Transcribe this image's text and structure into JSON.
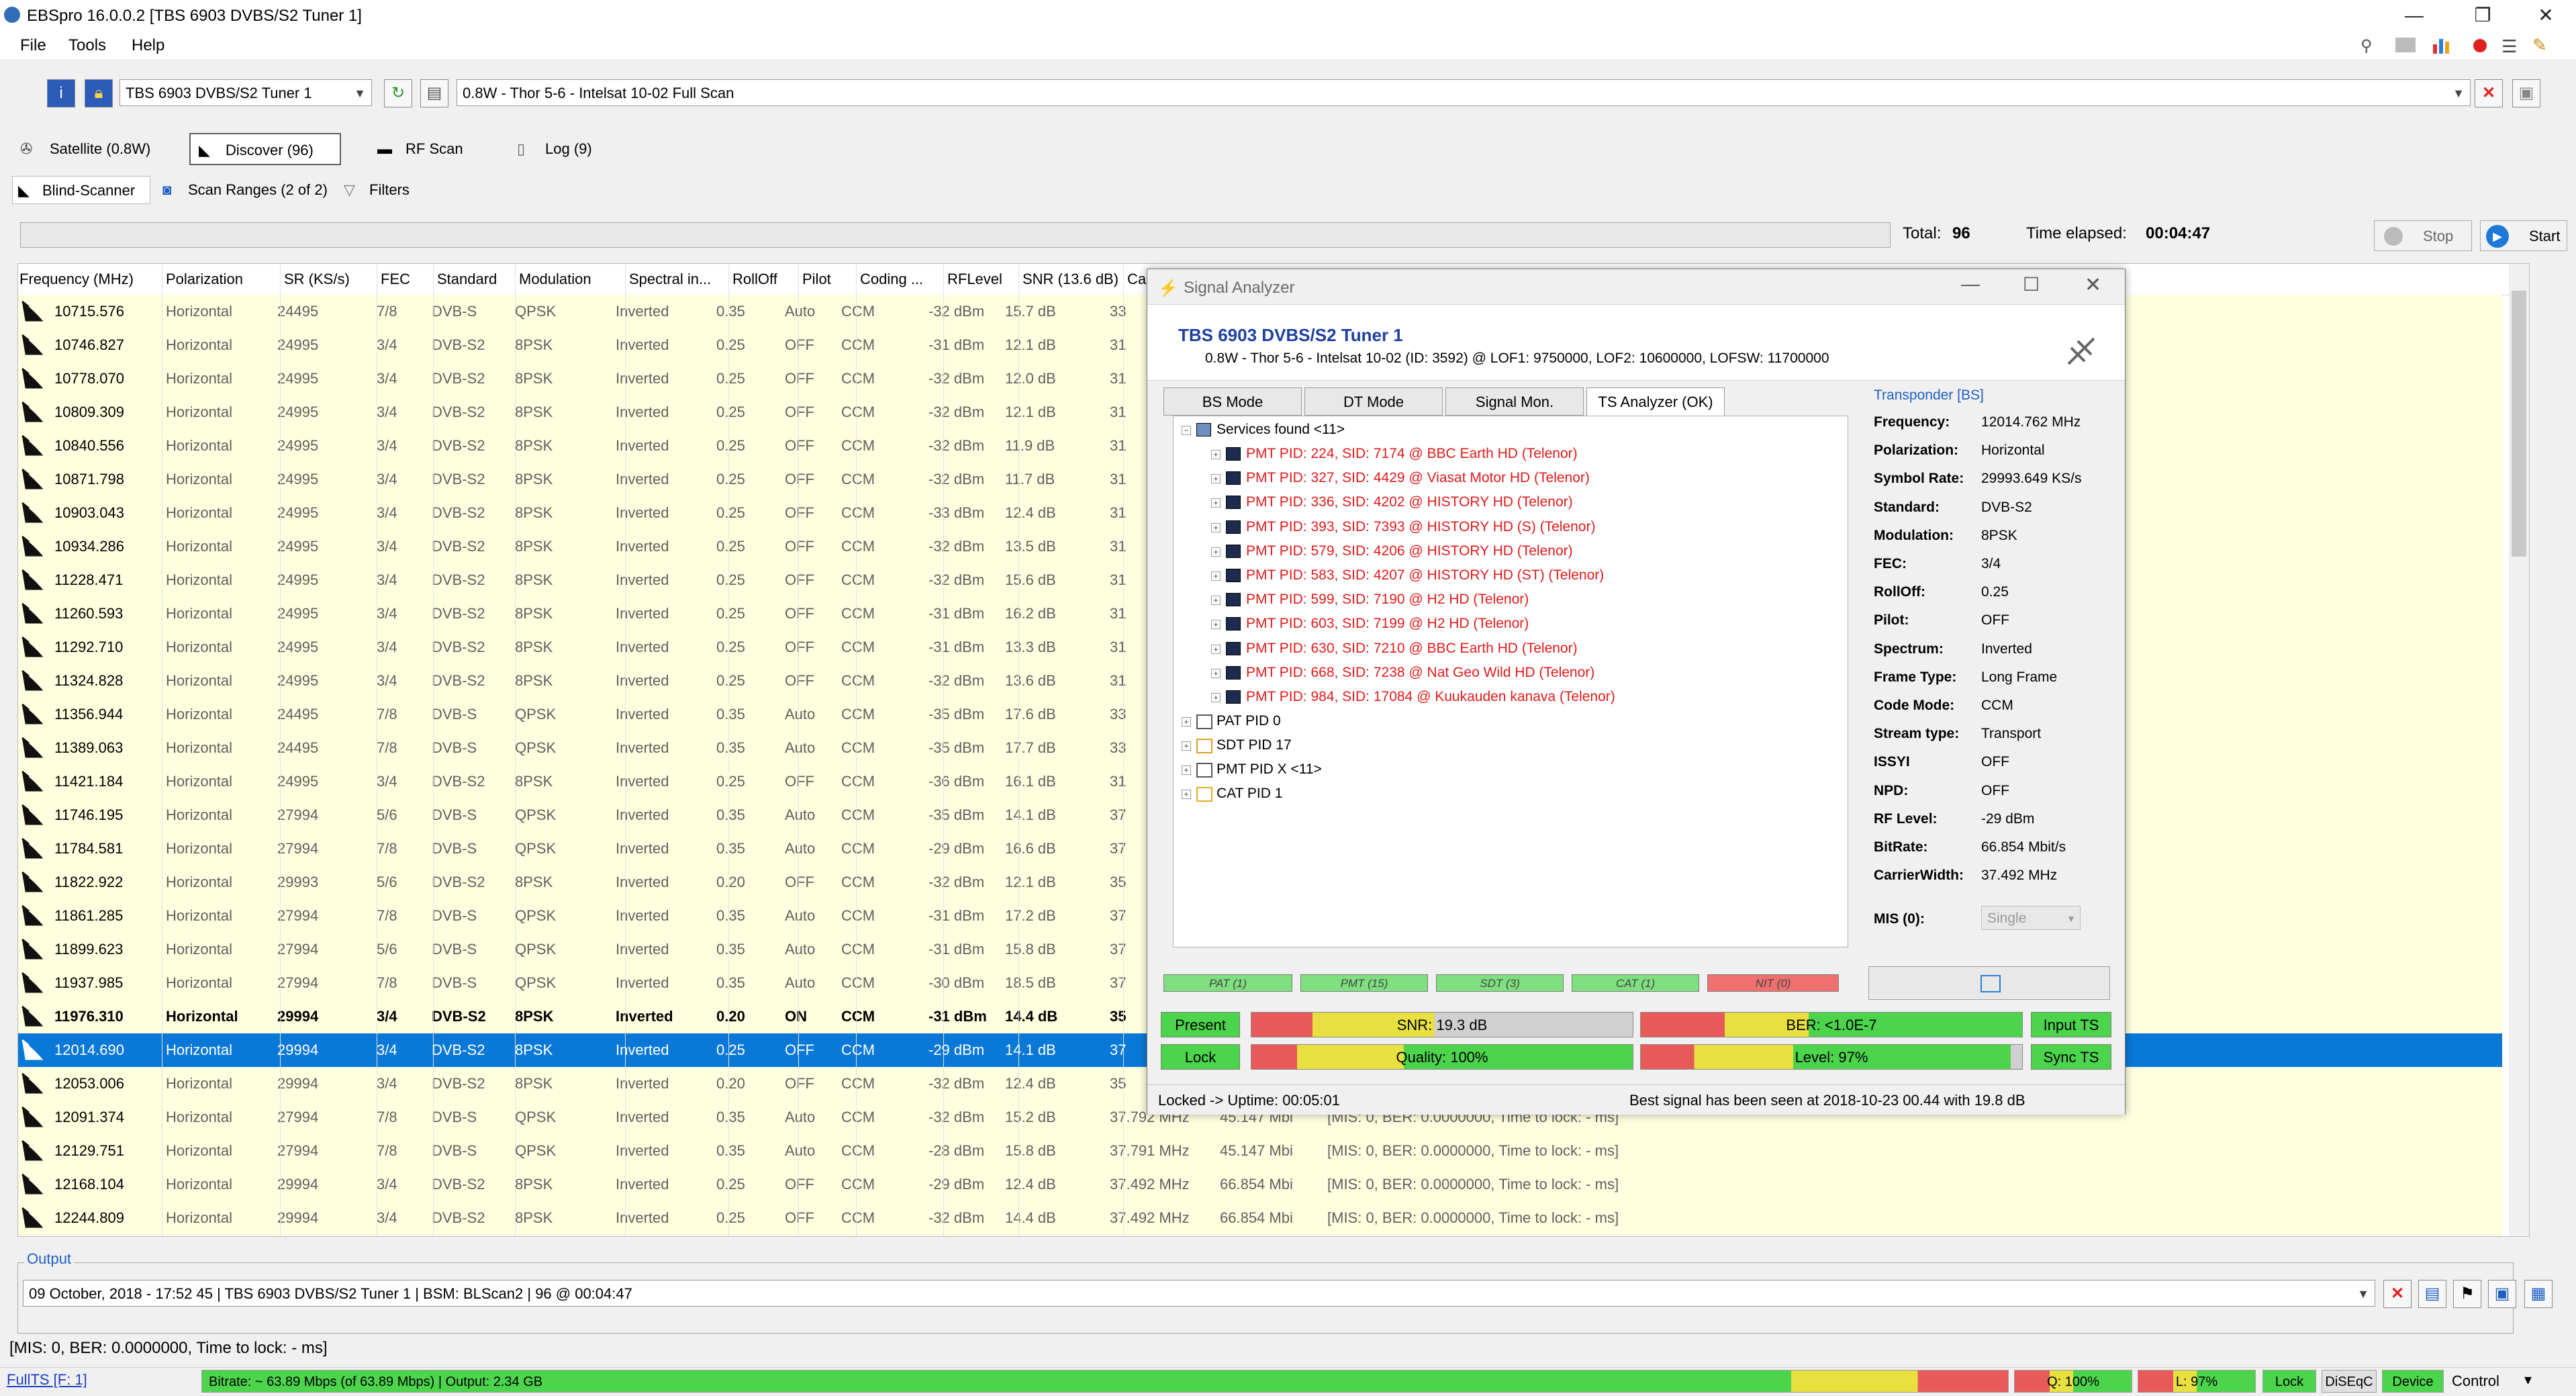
{
  "window": {
    "title": "EBSpro 16.0.0.2 [TBS 6903 DVBS/S2 Tuner 1]",
    "min": "—",
    "max": "❐",
    "close": "✕"
  },
  "menu": [
    "File",
    "Tools",
    "Help"
  ],
  "toolbar": {
    "tuner": "TBS 6903 DVBS/S2 Tuner 1",
    "satellite": "0.8W - Thor 5-6 - Intelsat 10-02 Full Scan"
  },
  "tabs": [
    "Satellite (0.8W)",
    "Discover (96)",
    "RF Scan",
    "Log (9)"
  ],
  "subtabs": [
    "Blind-Scanner",
    "Scan Ranges (2 of 2)",
    "Filters"
  ],
  "scan": {
    "total_label": "Total:",
    "total": "96",
    "elapsed_label": "Time elapsed:",
    "elapsed": "00:04:47",
    "stop": "Stop",
    "start": "Start"
  },
  "columns": [
    "Frequency (MHz)",
    "Polarization",
    "SR (KS/s)",
    "FEC",
    "Standard",
    "Modulation",
    "Spectral in...",
    "RollOff",
    "Pilot",
    "Coding ...",
    "RFLevel",
    "SNR (13.6 dB)",
    "Ca"
  ],
  "rows": [
    [
      "10715.576",
      "Horizontal",
      "24495",
      "7/8",
      "DVB-S",
      "QPSK",
      "Inverted",
      "0.35",
      "Auto",
      "CCM",
      "-32 dBm",
      "15.7 dB",
      "33",
      "",
      "",
      ""
    ],
    [
      "10746.827",
      "Horizontal",
      "24995",
      "3/4",
      "DVB-S2",
      "8PSK",
      "Inverted",
      "0.25",
      "OFF",
      "CCM",
      "-31 dBm",
      "12.1 dB",
      "31",
      "",
      "",
      ""
    ],
    [
      "10778.070",
      "Horizontal",
      "24995",
      "3/4",
      "DVB-S2",
      "8PSK",
      "Inverted",
      "0.25",
      "OFF",
      "CCM",
      "-32 dBm",
      "12.0 dB",
      "31",
      "",
      "",
      ""
    ],
    [
      "10809.309",
      "Horizontal",
      "24995",
      "3/4",
      "DVB-S2",
      "8PSK",
      "Inverted",
      "0.25",
      "OFF",
      "CCM",
      "-32 dBm",
      "12.1 dB",
      "31",
      "",
      "",
      ""
    ],
    [
      "10840.556",
      "Horizontal",
      "24995",
      "3/4",
      "DVB-S2",
      "8PSK",
      "Inverted",
      "0.25",
      "OFF",
      "CCM",
      "-32 dBm",
      "11.9 dB",
      "31",
      "",
      "",
      ""
    ],
    [
      "10871.798",
      "Horizontal",
      "24995",
      "3/4",
      "DVB-S2",
      "8PSK",
      "Inverted",
      "0.25",
      "OFF",
      "CCM",
      "-32 dBm",
      "11.7 dB",
      "31",
      "",
      "",
      ""
    ],
    [
      "10903.043",
      "Horizontal",
      "24995",
      "3/4",
      "DVB-S2",
      "8PSK",
      "Inverted",
      "0.25",
      "OFF",
      "CCM",
      "-33 dBm",
      "12.4 dB",
      "31",
      "",
      "",
      ""
    ],
    [
      "10934.286",
      "Horizontal",
      "24995",
      "3/4",
      "DVB-S2",
      "8PSK",
      "Inverted",
      "0.25",
      "OFF",
      "CCM",
      "-32 dBm",
      "13.5 dB",
      "31",
      "",
      "",
      ""
    ],
    [
      "11228.471",
      "Horizontal",
      "24995",
      "3/4",
      "DVB-S2",
      "8PSK",
      "Inverted",
      "0.25",
      "OFF",
      "CCM",
      "-32 dBm",
      "15.6 dB",
      "31",
      "",
      "",
      ""
    ],
    [
      "11260.593",
      "Horizontal",
      "24995",
      "3/4",
      "DVB-S2",
      "8PSK",
      "Inverted",
      "0.25",
      "OFF",
      "CCM",
      "-31 dBm",
      "16.2 dB",
      "31",
      "",
      "",
      ""
    ],
    [
      "11292.710",
      "Horizontal",
      "24995",
      "3/4",
      "DVB-S2",
      "8PSK",
      "Inverted",
      "0.25",
      "OFF",
      "CCM",
      "-31 dBm",
      "13.3 dB",
      "31",
      "",
      "",
      ""
    ],
    [
      "11324.828",
      "Horizontal",
      "24995",
      "3/4",
      "DVB-S2",
      "8PSK",
      "Inverted",
      "0.25",
      "OFF",
      "CCM",
      "-32 dBm",
      "13.6 dB",
      "31",
      "",
      "",
      ""
    ],
    [
      "11356.944",
      "Horizontal",
      "24495",
      "7/8",
      "DVB-S",
      "QPSK",
      "Inverted",
      "0.35",
      "Auto",
      "CCM",
      "-35 dBm",
      "17.6 dB",
      "33",
      "",
      "",
      ""
    ],
    [
      "11389.063",
      "Horizontal",
      "24495",
      "7/8",
      "DVB-S",
      "QPSK",
      "Inverted",
      "0.35",
      "Auto",
      "CCM",
      "-35 dBm",
      "17.7 dB",
      "33",
      "",
      "",
      ""
    ],
    [
      "11421.184",
      "Horizontal",
      "24995",
      "3/4",
      "DVB-S2",
      "8PSK",
      "Inverted",
      "0.25",
      "OFF",
      "CCM",
      "-36 dBm",
      "16.1 dB",
      "31",
      "",
      "",
      ""
    ],
    [
      "11746.195",
      "Horizontal",
      "27994",
      "5/6",
      "DVB-S",
      "QPSK",
      "Inverted",
      "0.35",
      "Auto",
      "CCM",
      "-35 dBm",
      "14.1 dB",
      "37",
      "",
      "",
      ""
    ],
    [
      "11784.581",
      "Horizontal",
      "27994",
      "7/8",
      "DVB-S",
      "QPSK",
      "Inverted",
      "0.35",
      "Auto",
      "CCM",
      "-29 dBm",
      "16.6 dB",
      "37",
      "",
      "",
      ""
    ],
    [
      "11822.922",
      "Horizontal",
      "29993",
      "5/6",
      "DVB-S2",
      "8PSK",
      "Inverted",
      "0.20",
      "OFF",
      "CCM",
      "-32 dBm",
      "12.1 dB",
      "35",
      "",
      "",
      ""
    ],
    [
      "11861.285",
      "Horizontal",
      "27994",
      "7/8",
      "DVB-S",
      "QPSK",
      "Inverted",
      "0.35",
      "Auto",
      "CCM",
      "-31 dBm",
      "17.2 dB",
      "37",
      "",
      "",
      ""
    ],
    [
      "11899.623",
      "Horizontal",
      "27994",
      "5/6",
      "DVB-S",
      "QPSK",
      "Inverted",
      "0.35",
      "Auto",
      "CCM",
      "-31 dBm",
      "15.8 dB",
      "37",
      "",
      "",
      ""
    ],
    [
      "11937.985",
      "Horizontal",
      "27994",
      "7/8",
      "DVB-S",
      "QPSK",
      "Inverted",
      "0.35",
      "Auto",
      "CCM",
      "-30 dBm",
      "18.5 dB",
      "37",
      "",
      "",
      ""
    ],
    [
      "11976.310",
      "Horizontal",
      "29994",
      "3/4",
      "DVB-S2",
      "8PSK",
      "Inverted",
      "0.20",
      "ON",
      "CCM",
      "-31 dBm",
      "14.4 dB",
      "35",
      "",
      "",
      ""
    ],
    [
      "12014.690",
      "Horizontal",
      "29994",
      "3/4",
      "DVB-S2",
      "8PSK",
      "Inverted",
      "0.25",
      "OFF",
      "CCM",
      "-29 dBm",
      "14.1 dB",
      "37",
      "",
      "",
      ""
    ],
    [
      "12053.006",
      "Horizontal",
      "29994",
      "3/4",
      "DVB-S2",
      "8PSK",
      "Inverted",
      "0.20",
      "OFF",
      "CCM",
      "-32 dBm",
      "12.4 dB",
      "35",
      "",
      "",
      ""
    ],
    [
      "12091.374",
      "Horizontal",
      "27994",
      "7/8",
      "DVB-S",
      "QPSK",
      "Inverted",
      "0.35",
      "Auto",
      "CCM",
      "-32 dBm",
      "15.2 dB",
      "37.792 MHz",
      "45.147 Mbi",
      "[MIS: 0, BER: 0.0000000, Time to lock: - ms]"
    ],
    [
      "12129.751",
      "Horizontal",
      "27994",
      "7/8",
      "DVB-S",
      "QPSK",
      "Inverted",
      "0.35",
      "Auto",
      "CCM",
      "-28 dBm",
      "15.8 dB",
      "37.791 MHz",
      "45.147 Mbi",
      "[MIS: 0, BER: 0.0000000, Time to lock: - ms]"
    ],
    [
      "12168.104",
      "Horizontal",
      "29994",
      "3/4",
      "DVB-S2",
      "8PSK",
      "Inverted",
      "0.25",
      "OFF",
      "CCM",
      "-29 dBm",
      "12.4 dB",
      "37.492 MHz",
      "66.854 Mbi",
      "[MIS: 0, BER: 0.0000000, Time to lock: - ms]"
    ],
    [
      "12244.809",
      "Horizontal",
      "29994",
      "3/4",
      "DVB-S2",
      "8PSK",
      "Inverted",
      "0.25",
      "OFF",
      "CCM",
      "-32 dBm",
      "14.4 dB",
      "37.492 MHz",
      "66.854 Mbi",
      "[MIS: 0, BER: 0.0000000, Time to lock: - ms]"
    ]
  ],
  "output": {
    "label": "Output",
    "value": "09 October, 2018 - 17:52 45 | TBS 6903 DVBS/S2 Tuner 1 | BSM: BLScan2 | 96 @ 00:04:47"
  },
  "status_message": "[MIS: 0, BER: 0.0000000, Time to lock: - ms]",
  "statusbar": {
    "fullts": "FullTS [F: 1]",
    "bitrate": "Bitrate: ~ 63.89 Mbps (of 63.89 Mbps) | Output: 2.34 GB",
    "q": "Q: 100%",
    "l": "L: 97%",
    "lock": "Lock",
    "diseqc": "DiSEqC",
    "device": "Device",
    "control": "Control"
  },
  "signal_analyzer": {
    "title": "Signal Analyzer",
    "tuner": "TBS 6903 DVBS/S2 Tuner 1",
    "info": "0.8W - Thor 5-6 - Intelsat 10-02 (ID: 3592) @ LOF1: 9750000, LOF2: 10600000, LOFSW: 11700000",
    "tabs": [
      "BS Mode",
      "DT Mode",
      "Signal Mon.",
      "TS Analyzer (OK)"
    ],
    "tree_root": "Services found <11>",
    "services": [
      "PMT PID: 224, SID: 7174 @ BBC Earth HD (Telenor)",
      "PMT PID: 327, SID: 4429 @ Viasat Motor HD (Telenor)",
      "PMT PID: 336, SID: 4202 @ HISTORY HD (Telenor)",
      "PMT PID: 393, SID: 7393 @ HISTORY HD (S) (Telenor)",
      "PMT PID: 579, SID: 4206 @ HISTORY HD (Telenor)",
      "PMT PID: 583, SID: 4207 @ HISTORY HD (ST) (Telenor)",
      "PMT PID: 599, SID: 7190 @ H2 HD (Telenor)",
      "PMT PID: 603, SID: 7199 @ H2 HD (Telenor)",
      "PMT PID: 630, SID: 7210 @ BBC Earth HD (Telenor)",
      "PMT PID: 668, SID: 7238 @ Nat Geo Wild HD (Telenor)",
      "PMT PID: 984, SID: 17084 @ Kuukauden kanava (Telenor)"
    ],
    "tables": [
      "PAT PID 0",
      "SDT PID 17",
      "PMT PID X <11>",
      "CAT PID 1"
    ],
    "transponder_title": "Transponder [BS]",
    "transponder": [
      [
        "Frequency:",
        "12014.762 MHz"
      ],
      [
        "Polarization:",
        "Horizontal"
      ],
      [
        "Symbol Rate:",
        "29993.649 KS/s"
      ],
      [
        "Standard:",
        "DVB-S2"
      ],
      [
        "Modulation:",
        "8PSK"
      ],
      [
        "FEC:",
        "3/4"
      ],
      [
        "RollOff:",
        "0.25"
      ],
      [
        "Pilot:",
        "OFF"
      ],
      [
        "Spectrum:",
        "Inverted"
      ],
      [
        "Frame Type:",
        "Long Frame"
      ],
      [
        "Code Mode:",
        "CCM"
      ],
      [
        "Stream type:",
        "Transport"
      ],
      [
        "ISSYI",
        "OFF"
      ],
      [
        "NPD:",
        "OFF"
      ],
      [
        "RF Level:",
        "-29 dBm"
      ],
      [
        "BitRate:",
        "66.854 Mbit/s"
      ],
      [
        "CarrierWidth:",
        "37.492 MHz"
      ]
    ],
    "mis_label": "MIS (0):",
    "mis_value": "Single",
    "table_badges": [
      "PAT (1)",
      "PMT (15)",
      "SDT (3)",
      "CAT (1)",
      "NIT (0)"
    ],
    "present": "Present",
    "lock": "Lock",
    "snr": "SNR: 19.3 dB",
    "quality": "Quality: 100%",
    "ber": "BER: <1.0E-7",
    "level": "Level: 97%",
    "input_ts": "Input TS",
    "sync_ts": "Sync TS",
    "uptime": "Locked -> Uptime: 00:05:01",
    "best_signal": "Best signal has been seen at 2018-10-23 00.44 with 19.8 dB"
  },
  "colors": {
    "selection": "#0a78d7",
    "row_bg": "#ffffdf",
    "service_red": "#e21a1a",
    "ok_green": "#4cd44c",
    "nit_red": "#f07070"
  }
}
